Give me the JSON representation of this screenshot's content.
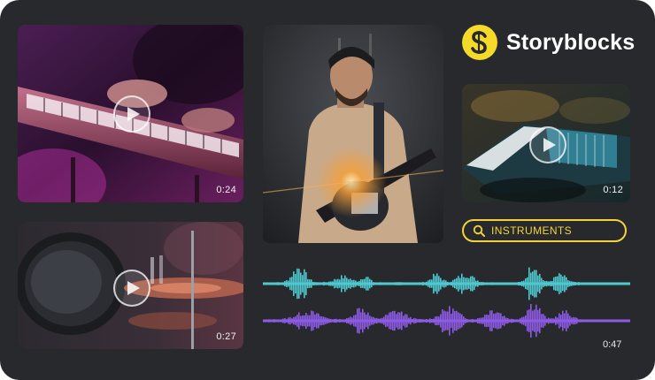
{
  "brand": {
    "name": "Storyblocks",
    "mark": "S"
  },
  "search": {
    "query": "INSTRUMENTS"
  },
  "videos": [
    {
      "id": "keyboard",
      "duration": "0:24",
      "icon": "play-icon"
    },
    {
      "id": "drums",
      "duration": "0:27",
      "icon": "play-icon"
    },
    {
      "id": "synth",
      "duration": "0:12",
      "icon": "play-icon"
    }
  ],
  "audio": {
    "duration": "0:47"
  },
  "colors": {
    "frame": "#27292c",
    "accent": "#f6da2a",
    "wave_top": "#4ec9cf",
    "wave_bottom": "#8e5be6"
  }
}
